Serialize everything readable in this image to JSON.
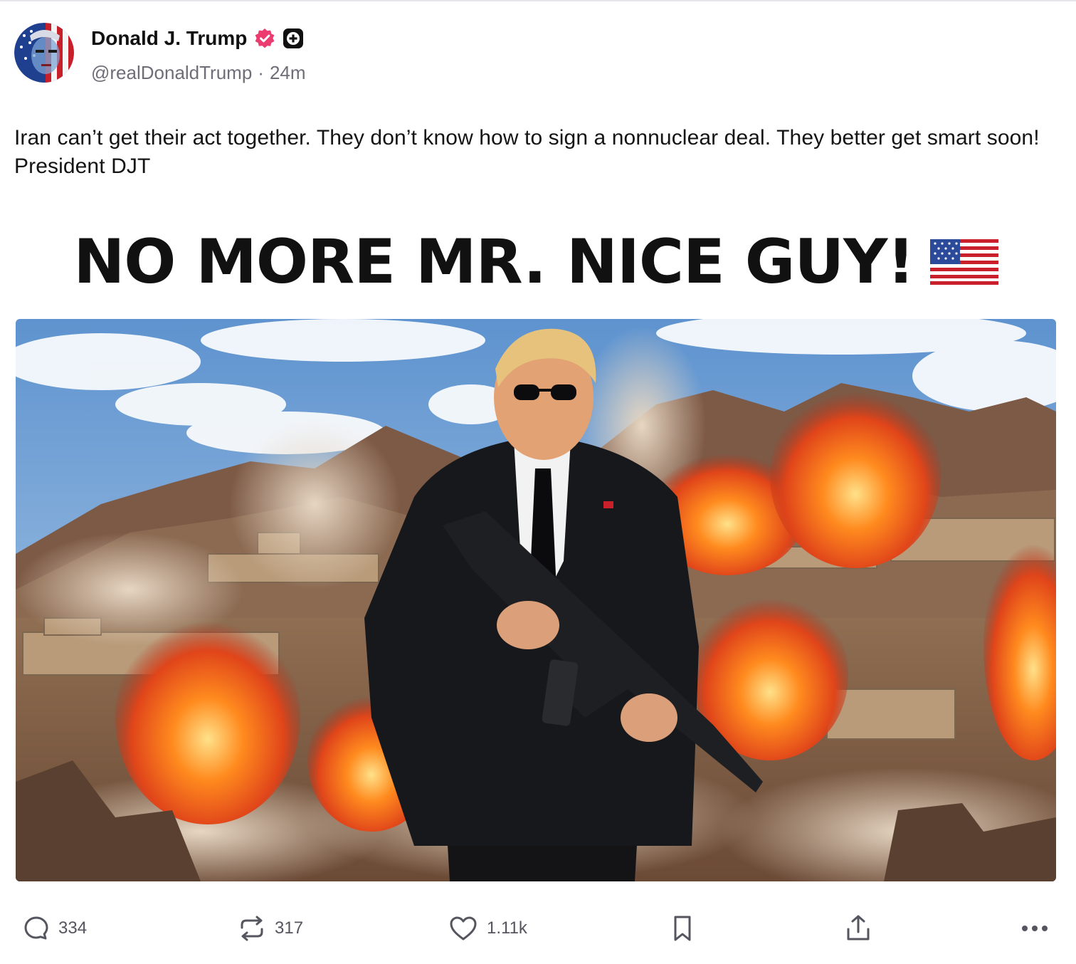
{
  "post": {
    "author": {
      "display_name": "Donald J. Trump",
      "handle": "@realDonaldTrump",
      "time_separator": "·",
      "time_ago": "24m",
      "badges": [
        "verified-badge-icon",
        "plus-badge-icon"
      ]
    },
    "text": "Iran can’t get their act together. They don’t know how to sign a nonnuclear deal. They better get smart soon! President DJT",
    "media": {
      "headline": "NO MORE MR. NICE GUY!",
      "headline_emoji": "us-flag-icon"
    },
    "actions": {
      "replies": "334",
      "reposts": "317",
      "likes": "1.11k",
      "bookmark_icon": "bookmark-icon",
      "share_icon": "share-icon",
      "more_icon": "more-icon"
    }
  },
  "colors": {
    "verified_badge": "#ec3b6e",
    "text_primary": "#111111",
    "text_secondary": "#6e6e78",
    "action_icon": "#55555f"
  }
}
